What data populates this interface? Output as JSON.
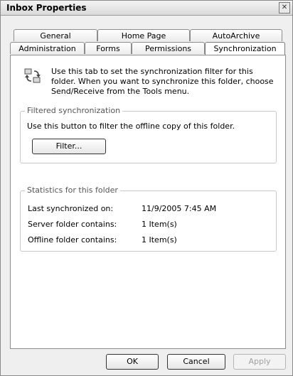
{
  "window": {
    "title": "Inbox Properties",
    "close_glyph": "✕"
  },
  "tabs_row1": [
    "General",
    "Home Page",
    "AutoArchive"
  ],
  "tabs_row2": [
    "Administration",
    "Forms",
    "Permissions",
    "Synchronization"
  ],
  "active_tab": "Synchronization",
  "description": "Use this tab to set the synchronization filter for this folder. When you want to synchronize this folder, choose Send/Receive from the Tools menu.",
  "filtered": {
    "label": "Filtered synchronization",
    "text": "Use this button to filter the offline copy of this folder.",
    "button": "Filter..."
  },
  "stats": {
    "label": "Statistics for this folder",
    "rows": [
      {
        "label": "Last synchronized on:",
        "value": "11/9/2005 7:45 AM"
      },
      {
        "label": "Server folder contains:",
        "value": "1 Item(s)"
      },
      {
        "label": "Offline folder contains:",
        "value": "1 Item(s)"
      }
    ]
  },
  "buttons": {
    "ok": "OK",
    "cancel": "Cancel",
    "apply": "Apply"
  },
  "icons": {
    "sync": "sync-arrows-icon"
  }
}
